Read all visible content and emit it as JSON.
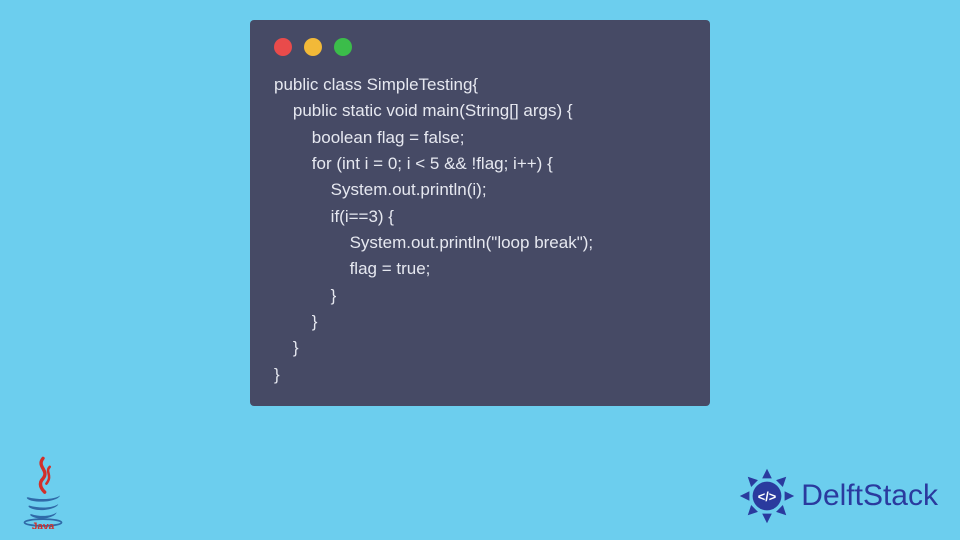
{
  "window": {
    "dots": [
      "red",
      "yellow",
      "green"
    ]
  },
  "code": {
    "lines": [
      "public class SimpleTesting{",
      "    public static void main(String[] args) {",
      "        boolean flag = false;",
      "        for (int i = 0; i < 5 && !flag; i++) {",
      "            System.out.println(i);",
      "            if(i==3) {",
      "                System.out.println(\"loop break\");",
      "                flag = true;",
      "            }",
      "        }",
      "    }",
      "}"
    ]
  },
  "logos": {
    "java_label": "Java",
    "delft_label": "DelftStack"
  },
  "colors": {
    "page_bg": "#6cceee",
    "window_bg": "#464a65",
    "code_fg": "#e6e8f0",
    "delft_fg": "#2a3a9e",
    "java_red": "#d1302a",
    "java_blue": "#2f6aa8"
  }
}
